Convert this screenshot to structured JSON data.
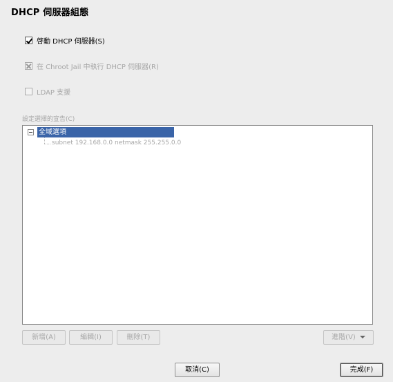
{
  "dialog": {
    "title": "DHCP 伺服器組態"
  },
  "checkboxes": [
    {
      "label": "啓動 DHCP 伺服器(S)",
      "checked": true,
      "enabled": true
    },
    {
      "label": "在 Chroot Jail 中執行 DHCP 伺服器(R)",
      "checked": true,
      "enabled": false
    },
    {
      "label": "LDAP 支援",
      "checked": false,
      "enabled": false
    }
  ],
  "declarations": {
    "label": "設定選擇的宣告(C)",
    "root": "全域選項",
    "children": [
      "subnet 192.168.0.0 netmask 255.255.0.0"
    ]
  },
  "buttons": {
    "add": "新增(A)",
    "edit": "編輯(I)",
    "delete": "刪除(T)",
    "advanced": "進階(V)",
    "cancel": "取消(C)",
    "finish": "完成(F)"
  }
}
